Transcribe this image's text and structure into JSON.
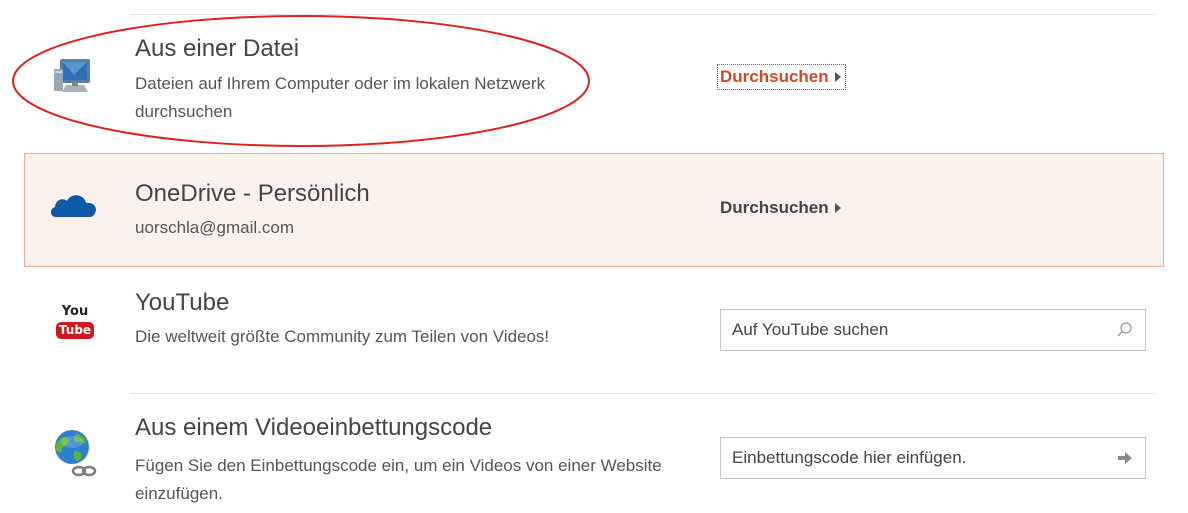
{
  "sources": [
    {
      "title": "Aus einer Datei",
      "description": "Dateien auf Ihrem Computer oder im lokalen Netzwerk durchsuchen",
      "action_label": "Durchsuchen",
      "icon": "computer-monitor-icon"
    },
    {
      "title": "OneDrive - Persönlich",
      "description": "uorschla@gmail.com",
      "action_label": "Durchsuchen",
      "icon": "onedrive-cloud-icon",
      "selected": true
    },
    {
      "title": "YouTube",
      "description": "Die weltweit größte Community zum Teilen von Videos!",
      "search_placeholder": "Auf YouTube suchen",
      "icon": "youtube-logo-icon",
      "logo_text_top": "You",
      "logo_text_bottom": "Tube"
    },
    {
      "title": "Aus einem Videoeinbettungscode",
      "description": "Fügen Sie den Einbettungscode ein, um ein Videos von einer Website einzufügen.",
      "input_placeholder": "Einbettungscode hier einfügen.",
      "icon": "globe-link-icon"
    }
  ],
  "colors": {
    "accent": "#d24726",
    "selected_bg": "#fdf1ee",
    "selected_border": "#efab9c",
    "onedrive": "#0f5aa8",
    "youtube_red": "#cc181e"
  }
}
